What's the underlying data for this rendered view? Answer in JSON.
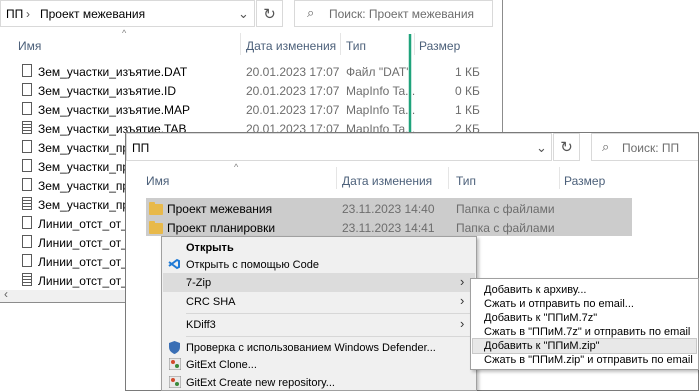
{
  "window_back": {
    "breadcrumb": [
      "ПП",
      "Проект межевания"
    ],
    "search_placeholder": "Поиск: Проект межевания",
    "columns": {
      "name": "Имя",
      "date": "Дата изменения",
      "type": "Тип",
      "size": "Размер"
    },
    "files": [
      {
        "name": "Зем_участки_изъятие.DAT",
        "date": "20.01.2023 17:07",
        "type": "Файл \"DAT\"",
        "size": "1 КБ",
        "icon": "file-icon"
      },
      {
        "name": "Зем_участки_изъятие.ID",
        "date": "20.01.2023 17:07",
        "type": "MapInfo Ta...",
        "size": "0 КБ",
        "icon": "file-icon"
      },
      {
        "name": "Зем_участки_изъятие.MAP",
        "date": "20.01.2023 17:07",
        "type": "MapInfo Ta...",
        "size": "1 КБ",
        "icon": "file-icon"
      },
      {
        "name": "Зем_участки_изъятие.TAB",
        "date": "20.01.2023 17:07",
        "type": "MapInfo Ta...",
        "size": "2 КБ",
        "icon": "mapinfo-table-icon"
      },
      {
        "name": "Зем_участки_пр.DAT",
        "icon": "file-icon"
      },
      {
        "name": "Зем_участки_пр.ID",
        "icon": "file-icon"
      },
      {
        "name": "Зем_участки_пр.MAP",
        "icon": "file-icon"
      },
      {
        "name": "Зем_участки_пр.TAB",
        "icon": "mapinfo-table-icon"
      },
      {
        "name": "Линии_отст_от_крас",
        "icon": "file-icon"
      },
      {
        "name": "Линии_отст_от_крас",
        "icon": "file-icon"
      },
      {
        "name": "Линии_отст_от_крас",
        "icon": "file-icon"
      },
      {
        "name": "Линии_отст_от_крас",
        "icon": "mapinfo-table-icon"
      }
    ]
  },
  "window_front": {
    "breadcrumb": "ПП",
    "search_placeholder": "Поиск: ПП",
    "columns": {
      "name": "Имя",
      "date": "Дата изменения",
      "type": "Тип",
      "size": "Размер"
    },
    "folders": [
      {
        "name": "Проект межевания",
        "date": "23.11.2023 14:40",
        "type": "Папка с файлами"
      },
      {
        "name": "Проект планировки",
        "date": "23.11.2023 14:41",
        "type": "Папка с файлами"
      }
    ]
  },
  "context_menu": {
    "items": [
      {
        "label": "Открыть",
        "bold": true
      },
      {
        "label": "Открыть с помощью Code",
        "icon": "vscode-icon"
      },
      {
        "label": "7-Zip",
        "submenu": true
      },
      {
        "label": "CRC SHA",
        "submenu": true
      },
      {
        "label": "KDiff3",
        "submenu": true
      },
      {
        "label": "Проверка с использованием Windows Defender...",
        "icon": "windows-defender-icon"
      },
      {
        "label": "GitExt Clone...",
        "icon": "gitext-icon"
      },
      {
        "label": "GitExt Create new repository...",
        "icon": "gitext-icon"
      }
    ]
  },
  "submenu_7zip": {
    "items": [
      "Добавить к архиву...",
      "Сжать и отправить по email...",
      "Добавить к \"ППиМ.7z\"",
      "Сжать в \"ППиМ.7z\" и отправить по email",
      "Добавить к \"ППиМ.zip\"",
      "Сжать в \"ППиМ.zip\" и отправить по email"
    ],
    "highlighted_index": 4
  },
  "colors": {
    "arrow": "#1fa37b",
    "folder": "#e8b94a",
    "selection": "#cccccc",
    "header_text": "#4c607a"
  }
}
